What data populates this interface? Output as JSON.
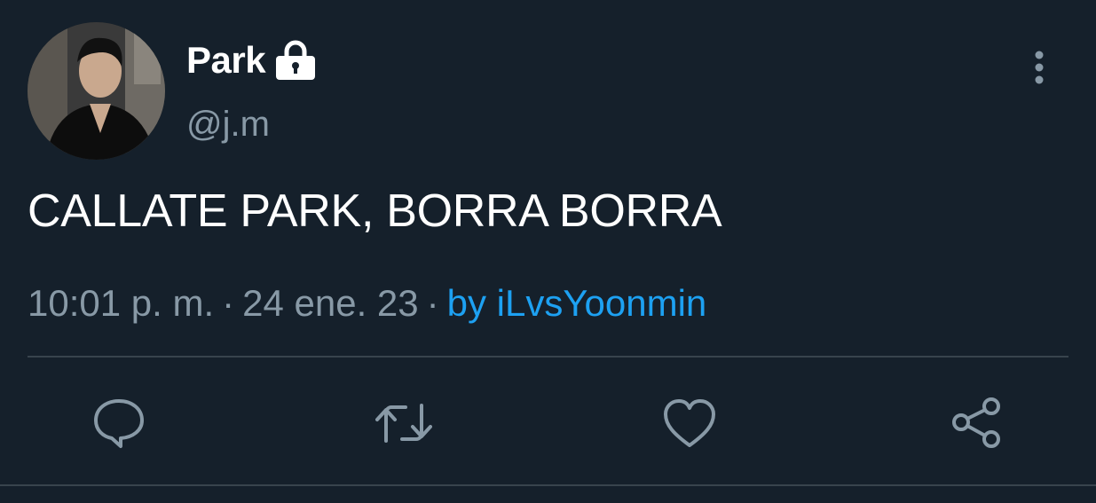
{
  "tweet": {
    "display_name": "Park",
    "handle": "@j.m",
    "text": "CALLATE PARK, BORRA BORRA",
    "time": "10:01 p. m.",
    "separator": "·",
    "date": "24 ene. 23",
    "source": "by iLvsYoonmin",
    "protected_icon": "lock-icon"
  },
  "actions": [
    {
      "name": "reply",
      "icon": "comment-icon"
    },
    {
      "name": "retweet",
      "icon": "retweet-icon"
    },
    {
      "name": "like",
      "icon": "heart-icon"
    },
    {
      "name": "share",
      "icon": "share-icon"
    }
  ],
  "colors": {
    "background": "#15202b",
    "primary_text": "#ffffff",
    "secondary_text": "#8899a6",
    "link": "#1da1f2",
    "divider": "#38444d"
  }
}
